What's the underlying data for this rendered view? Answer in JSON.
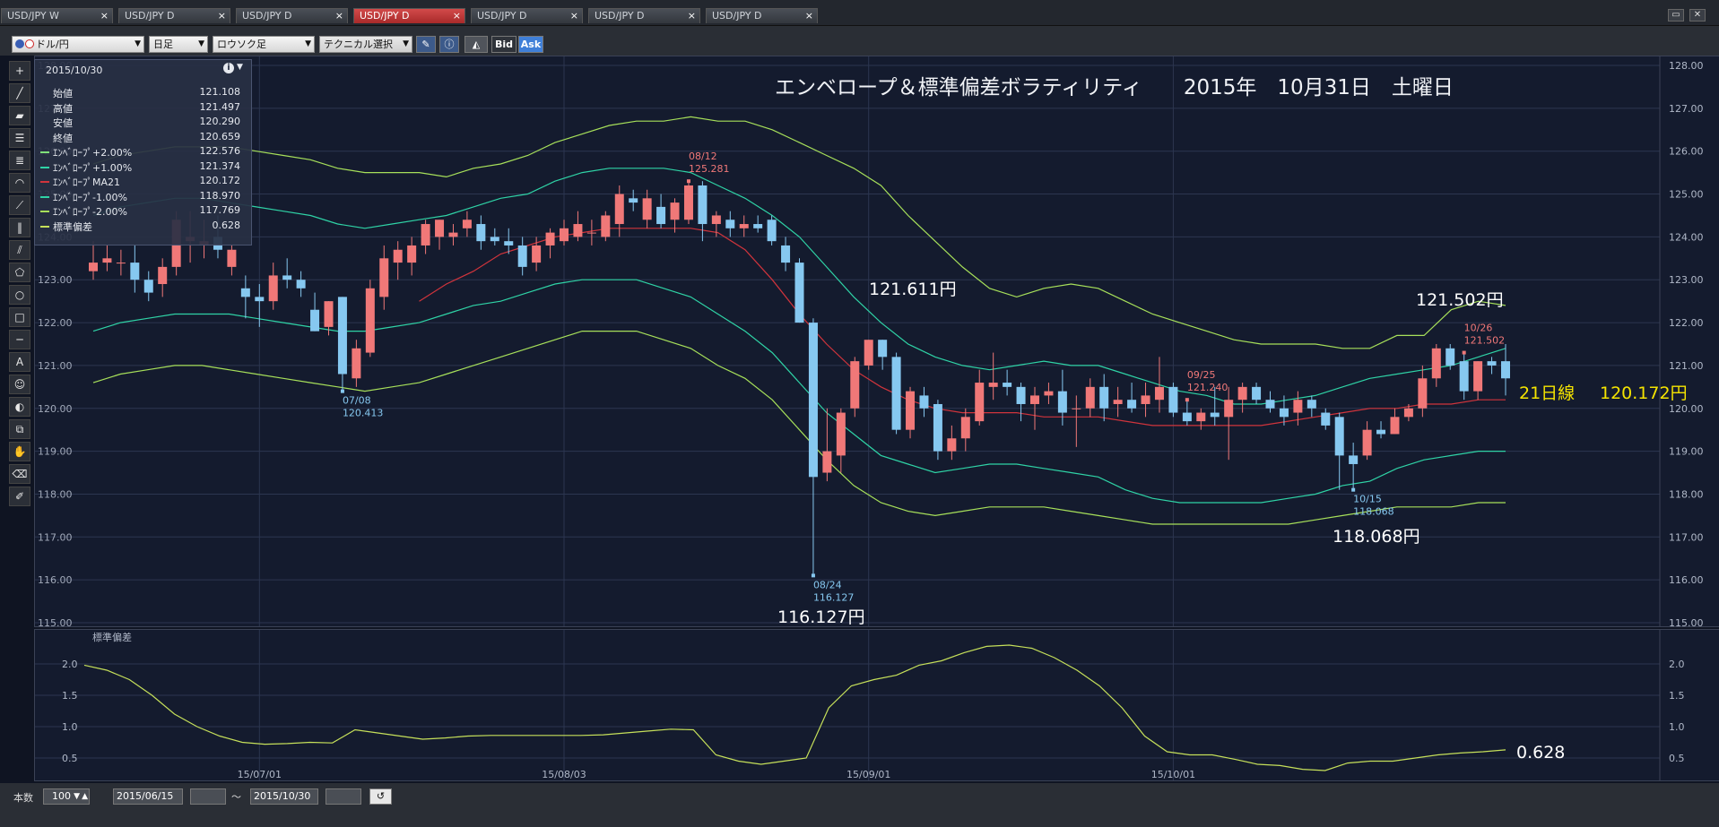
{
  "tabs": [
    {
      "label": "USD/JPY W",
      "active": false
    },
    {
      "label": "USD/JPY D",
      "active": false
    },
    {
      "label": "USD/JPY D",
      "active": false
    },
    {
      "label": "USD/JPY D",
      "active": true
    },
    {
      "label": "USD/JPY D",
      "active": false
    },
    {
      "label": "USD/JPY D",
      "active": false
    },
    {
      "label": "USD/JPY D",
      "active": false
    }
  ],
  "tab_close": "×",
  "toolbar": {
    "pair": "ドル/円",
    "period": "日足",
    "chart_type": "ロウソク足",
    "technical": "テクニカル選択",
    "bid": "Bid",
    "ask": "Ask"
  },
  "info_panel": {
    "date": "2015/10/30",
    "rows": [
      {
        "label": "始値",
        "value": "121.108"
      },
      {
        "label": "高値",
        "value": "121.497"
      },
      {
        "label": "安値",
        "value": "120.290"
      },
      {
        "label": "終値",
        "value": "120.659"
      },
      {
        "label": "ｴﾝﾍﾞﾛｰﾌﾟ+2.00%",
        "value": "122.576",
        "color": "#7fe07a"
      },
      {
        "label": "ｴﾝﾍﾞﾛｰﾌﾟ+1.00%",
        "value": "121.374",
        "color": "#2fd3a6"
      },
      {
        "label": "ｴﾝﾍﾞﾛｰﾌﾟMA21",
        "value": "120.172",
        "color": "#d0343c"
      },
      {
        "label": "ｴﾝﾍﾞﾛｰﾌﾟ-1.00%",
        "value": "118.970",
        "color": "#2fd3a6"
      },
      {
        "label": "ｴﾝﾍﾞﾛｰﾌﾟ-2.00%",
        "value": "117.769",
        "color": "#a7e05a"
      },
      {
        "label": "標準偏差",
        "value": "0.628",
        "color": "#c6e05a"
      }
    ]
  },
  "chart_title": "エンベロープ＆標準偏差ボラティリティ　　2015年　10月31日　土曜日",
  "colors": {
    "up": "#f07878",
    "down": "#86c8f0",
    "ma": "#d0343c",
    "env1": "#2fd3a6",
    "env2": "#a7e05a",
    "std": "#c6e05a",
    "grid": "#2c3650",
    "bg": "#141b2e"
  },
  "chart_data": {
    "type": "candlestick",
    "y_axis": {
      "min": 115,
      "max": 128,
      "ticks": [
        "128.00",
        "127.00",
        "126.00",
        "125.00",
        "124.00",
        "123.00",
        "122.00",
        "121.00",
        "120.00",
        "119.00",
        "118.00",
        "117.00",
        "116.00",
        "115.00"
      ]
    },
    "x_tick_labels": [
      "15/07/01",
      "15/08/03",
      "15/09/01",
      "15/10/01"
    ],
    "candles": [
      {
        "o": 123.2,
        "h": 123.9,
        "l": 123.0,
        "c": 123.4
      },
      {
        "o": 123.4,
        "h": 123.8,
        "l": 123.2,
        "c": 123.5
      },
      {
        "o": 123.4,
        "h": 123.7,
        "l": 123.1,
        "c": 123.4
      },
      {
        "o": 123.4,
        "h": 123.8,
        "l": 122.7,
        "c": 123.0
      },
      {
        "o": 123.0,
        "h": 123.2,
        "l": 122.5,
        "c": 122.7
      },
      {
        "o": 122.9,
        "h": 123.5,
        "l": 122.6,
        "c": 123.3
      },
      {
        "o": 123.3,
        "h": 124.6,
        "l": 123.1,
        "c": 124.4
      },
      {
        "o": 123.9,
        "h": 124.6,
        "l": 123.4,
        "c": 124.0
      },
      {
        "o": 123.8,
        "h": 124.4,
        "l": 123.5,
        "c": 123.9
      },
      {
        "o": 124.0,
        "h": 124.5,
        "l": 123.5,
        "c": 123.7
      },
      {
        "o": 123.3,
        "h": 123.8,
        "l": 123.1,
        "c": 123.7
      },
      {
        "o": 122.8,
        "h": 123.1,
        "l": 122.1,
        "c": 122.6
      },
      {
        "o": 122.6,
        "h": 122.9,
        "l": 121.9,
        "c": 122.5
      },
      {
        "o": 122.5,
        "h": 123.4,
        "l": 122.3,
        "c": 123.1
      },
      {
        "o": 123.1,
        "h": 123.5,
        "l": 122.8,
        "c": 123.0
      },
      {
        "o": 123.0,
        "h": 123.2,
        "l": 122.6,
        "c": 122.8
      },
      {
        "o": 122.3,
        "h": 122.7,
        "l": 121.8,
        "c": 121.8
      },
      {
        "o": 121.9,
        "h": 122.5,
        "l": 121.7,
        "c": 122.5
      },
      {
        "o": 122.6,
        "h": 122.6,
        "l": 120.4,
        "c": 120.8
      },
      {
        "o": 120.7,
        "h": 121.6,
        "l": 120.5,
        "c": 121.4
      },
      {
        "o": 121.3,
        "h": 123.0,
        "l": 121.2,
        "c": 122.8
      },
      {
        "o": 122.6,
        "h": 123.8,
        "l": 122.3,
        "c": 123.5
      },
      {
        "o": 123.4,
        "h": 123.9,
        "l": 123.0,
        "c": 123.7
      },
      {
        "o": 123.4,
        "h": 124.0,
        "l": 123.1,
        "c": 123.8
      },
      {
        "o": 123.8,
        "h": 124.4,
        "l": 123.6,
        "c": 124.3
      },
      {
        "o": 124.0,
        "h": 124.4,
        "l": 123.7,
        "c": 124.4
      },
      {
        "o": 124.0,
        "h": 124.3,
        "l": 123.8,
        "c": 124.1
      },
      {
        "o": 124.2,
        "h": 124.6,
        "l": 124.0,
        "c": 124.4
      },
      {
        "o": 124.3,
        "h": 124.5,
        "l": 123.7,
        "c": 123.9
      },
      {
        "o": 124.0,
        "h": 124.2,
        "l": 123.8,
        "c": 123.9
      },
      {
        "o": 123.9,
        "h": 124.2,
        "l": 123.6,
        "c": 123.8
      },
      {
        "o": 123.8,
        "h": 124.0,
        "l": 123.1,
        "c": 123.3
      },
      {
        "o": 123.4,
        "h": 124.0,
        "l": 123.2,
        "c": 123.8
      },
      {
        "o": 123.8,
        "h": 124.2,
        "l": 123.5,
        "c": 124.1
      },
      {
        "o": 123.9,
        "h": 124.4,
        "l": 123.8,
        "c": 124.2
      },
      {
        "o": 124.0,
        "h": 124.6,
        "l": 123.9,
        "c": 124.3
      },
      {
        "o": 124.1,
        "h": 124.4,
        "l": 123.8,
        "c": 124.1
      },
      {
        "o": 124.0,
        "h": 124.6,
        "l": 123.9,
        "c": 124.5
      },
      {
        "o": 124.3,
        "h": 125.2,
        "l": 124.0,
        "c": 125.0
      },
      {
        "o": 124.9,
        "h": 125.1,
        "l": 124.6,
        "c": 124.8
      },
      {
        "o": 124.4,
        "h": 125.1,
        "l": 124.2,
        "c": 124.9
      },
      {
        "o": 124.7,
        "h": 125.0,
        "l": 124.2,
        "c": 124.3
      },
      {
        "o": 124.4,
        "h": 124.9,
        "l": 124.1,
        "c": 124.8
      },
      {
        "o": 124.4,
        "h": 125.3,
        "l": 124.3,
        "c": 125.2
      },
      {
        "o": 125.2,
        "h": 125.3,
        "l": 123.9,
        "c": 124.3
      },
      {
        "o": 124.3,
        "h": 124.6,
        "l": 124.0,
        "c": 124.5
      },
      {
        "o": 124.4,
        "h": 124.6,
        "l": 124.0,
        "c": 124.2
      },
      {
        "o": 124.2,
        "h": 124.5,
        "l": 124.0,
        "c": 124.3
      },
      {
        "o": 124.3,
        "h": 124.5,
        "l": 124.1,
        "c": 124.2
      },
      {
        "o": 124.4,
        "h": 124.5,
        "l": 123.8,
        "c": 123.9
      },
      {
        "o": 123.8,
        "h": 124.0,
        "l": 123.2,
        "c": 123.4
      },
      {
        "o": 123.4,
        "h": 123.5,
        "l": 122.0,
        "c": 122.0
      },
      {
        "o": 122.0,
        "h": 122.1,
        "l": 116.1,
        "c": 118.4
      },
      {
        "o": 118.5,
        "h": 120.0,
        "l": 118.3,
        "c": 119.0
      },
      {
        "o": 118.9,
        "h": 120.0,
        "l": 118.5,
        "c": 119.9
      },
      {
        "o": 120.0,
        "h": 121.2,
        "l": 119.8,
        "c": 121.1
      },
      {
        "o": 121.0,
        "h": 121.6,
        "l": 120.9,
        "c": 121.6
      },
      {
        "o": 121.6,
        "h": 121.6,
        "l": 120.9,
        "c": 121.2
      },
      {
        "o": 121.2,
        "h": 121.3,
        "l": 119.4,
        "c": 119.5
      },
      {
        "o": 119.5,
        "h": 120.5,
        "l": 119.3,
        "c": 120.4
      },
      {
        "o": 120.3,
        "h": 120.5,
        "l": 119.8,
        "c": 120.0
      },
      {
        "o": 120.1,
        "h": 120.2,
        "l": 118.8,
        "c": 119.0
      },
      {
        "o": 119.0,
        "h": 119.6,
        "l": 118.8,
        "c": 119.3
      },
      {
        "o": 119.3,
        "h": 120.0,
        "l": 119.0,
        "c": 119.8
      },
      {
        "o": 119.7,
        "h": 120.9,
        "l": 119.6,
        "c": 120.6
      },
      {
        "o": 120.5,
        "h": 121.3,
        "l": 120.2,
        "c": 120.6
      },
      {
        "o": 120.6,
        "h": 120.9,
        "l": 120.3,
        "c": 120.5
      },
      {
        "o": 120.5,
        "h": 120.6,
        "l": 119.7,
        "c": 120.1
      },
      {
        "o": 120.1,
        "h": 120.5,
        "l": 119.5,
        "c": 120.3
      },
      {
        "o": 120.3,
        "h": 120.6,
        "l": 120.1,
        "c": 120.4
      },
      {
        "o": 120.4,
        "h": 120.9,
        "l": 119.6,
        "c": 119.9
      },
      {
        "o": 120.0,
        "h": 120.3,
        "l": 119.1,
        "c": 120.0
      },
      {
        "o": 120.0,
        "h": 120.7,
        "l": 119.8,
        "c": 120.5
      },
      {
        "o": 120.5,
        "h": 120.8,
        "l": 119.7,
        "c": 120.0
      },
      {
        "o": 120.1,
        "h": 120.5,
        "l": 119.8,
        "c": 120.2
      },
      {
        "o": 120.2,
        "h": 120.6,
        "l": 119.9,
        "c": 120.0
      },
      {
        "o": 120.1,
        "h": 120.6,
        "l": 119.8,
        "c": 120.3
      },
      {
        "o": 120.2,
        "h": 121.2,
        "l": 119.9,
        "c": 120.5
      },
      {
        "o": 120.5,
        "h": 120.6,
        "l": 119.8,
        "c": 119.9
      },
      {
        "o": 119.9,
        "h": 120.2,
        "l": 119.6,
        "c": 119.7
      },
      {
        "o": 119.7,
        "h": 120.0,
        "l": 119.5,
        "c": 119.9
      },
      {
        "o": 119.9,
        "h": 120.5,
        "l": 119.6,
        "c": 119.8
      },
      {
        "o": 119.8,
        "h": 120.5,
        "l": 118.8,
        "c": 120.2
      },
      {
        "o": 120.2,
        "h": 120.6,
        "l": 119.9,
        "c": 120.5
      },
      {
        "o": 120.5,
        "h": 120.6,
        "l": 120.1,
        "c": 120.2
      },
      {
        "o": 120.2,
        "h": 120.4,
        "l": 119.9,
        "c": 120.0
      },
      {
        "o": 120.0,
        "h": 120.3,
        "l": 119.6,
        "c": 119.8
      },
      {
        "o": 119.9,
        "h": 120.4,
        "l": 119.6,
        "c": 120.2
      },
      {
        "o": 120.2,
        "h": 120.3,
        "l": 119.8,
        "c": 120.0
      },
      {
        "o": 119.9,
        "h": 120.0,
        "l": 119.5,
        "c": 119.6
      },
      {
        "o": 119.8,
        "h": 119.9,
        "l": 118.1,
        "c": 118.9
      },
      {
        "o": 118.9,
        "h": 119.2,
        "l": 118.1,
        "c": 118.7
      },
      {
        "o": 118.9,
        "h": 119.7,
        "l": 118.8,
        "c": 119.5
      },
      {
        "o": 119.5,
        "h": 119.7,
        "l": 119.3,
        "c": 119.4
      },
      {
        "o": 119.4,
        "h": 120.0,
        "l": 119.4,
        "c": 119.8
      },
      {
        "o": 119.8,
        "h": 120.1,
        "l": 119.7,
        "c": 120.0
      },
      {
        "o": 120.0,
        "h": 121.0,
        "l": 119.8,
        "c": 120.7
      },
      {
        "o": 120.7,
        "h": 121.5,
        "l": 120.5,
        "c": 121.4
      },
      {
        "o": 121.4,
        "h": 121.5,
        "l": 120.9,
        "c": 121.0
      },
      {
        "o": 121.1,
        "h": 121.3,
        "l": 120.2,
        "c": 120.4
      },
      {
        "o": 120.4,
        "h": 121.1,
        "l": 120.2,
        "c": 121.1
      },
      {
        "o": 121.1,
        "h": 121.2,
        "l": 120.8,
        "c": 121.0
      },
      {
        "o": 121.1,
        "h": 121.5,
        "l": 120.3,
        "c": 120.7
      }
    ],
    "series": [
      {
        "name": "ｴﾝﾍﾞﾛｰﾌﾟ+2.00%",
        "values": [
          125.7,
          125.9,
          126.0,
          126.1,
          126.1,
          126.1,
          126.0,
          125.9,
          125.8,
          125.6,
          125.5,
          125.5,
          125.5,
          125.4,
          125.6,
          125.7,
          125.9,
          126.2,
          126.4,
          126.6,
          126.7,
          126.7,
          126.8,
          126.7,
          126.7,
          126.5,
          126.2,
          125.9,
          125.6,
          125.2,
          124.5,
          123.9,
          123.3,
          122.8,
          122.6,
          122.8,
          122.9,
          122.8,
          122.5,
          122.2,
          122.0,
          121.8,
          121.6,
          121.5,
          121.5,
          121.5,
          121.4,
          121.4,
          121.7,
          121.7,
          122.3,
          122.5,
          122.4
        ]
      },
      {
        "name": "ｴﾝﾍﾞﾛｰﾌﾟ+1.00%",
        "values": [
          124.5,
          124.7,
          124.8,
          124.9,
          124.9,
          124.8,
          124.7,
          124.6,
          124.5,
          124.3,
          124.2,
          124.3,
          124.4,
          124.5,
          124.7,
          124.9,
          125.0,
          125.3,
          125.5,
          125.6,
          125.6,
          125.6,
          125.5,
          125.2,
          124.9,
          124.5,
          124.0,
          123.3,
          122.6,
          122.0,
          121.5,
          121.2,
          121.0,
          120.9,
          121.0,
          121.1,
          121.0,
          121.0,
          120.8,
          120.6,
          120.4,
          120.3,
          120.1,
          120.1,
          120.2,
          120.3,
          120.5,
          120.7,
          120.8,
          120.9,
          121.0,
          121.2,
          121.4
        ]
      },
      {
        "name": "ｴﾝﾍﾞﾛｰﾌﾟ-1.00%",
        "values": [
          121.8,
          122.0,
          122.1,
          122.2,
          122.2,
          122.2,
          122.1,
          122.0,
          121.9,
          121.8,
          121.8,
          121.9,
          122.0,
          122.2,
          122.4,
          122.5,
          122.7,
          122.9,
          123.0,
          123.0,
          123.0,
          122.8,
          122.6,
          122.2,
          121.8,
          121.3,
          120.6,
          119.9,
          119.4,
          118.9,
          118.7,
          118.5,
          118.6,
          118.7,
          118.7,
          118.6,
          118.5,
          118.4,
          118.1,
          117.9,
          117.8,
          117.8,
          117.8,
          117.8,
          117.9,
          118.0,
          118.2,
          118.3,
          118.6,
          118.8,
          118.9,
          119.0,
          119.0
        ]
      },
      {
        "name": "ｴﾝﾍﾞﾛｰﾌﾟ-2.00%",
        "values": [
          120.6,
          120.8,
          120.9,
          121.0,
          121.0,
          120.9,
          120.8,
          120.7,
          120.6,
          120.5,
          120.4,
          120.5,
          120.6,
          120.8,
          121.0,
          121.2,
          121.4,
          121.6,
          121.8,
          121.8,
          121.8,
          121.6,
          121.4,
          121.0,
          120.7,
          120.2,
          119.5,
          118.8,
          118.2,
          117.8,
          117.6,
          117.5,
          117.6,
          117.7,
          117.7,
          117.7,
          117.6,
          117.5,
          117.4,
          117.3,
          117.3,
          117.3,
          117.3,
          117.3,
          117.3,
          117.4,
          117.5,
          117.6,
          117.7,
          117.7,
          117.7,
          117.8,
          117.8
        ]
      },
      {
        "name": "ｴﾝﾍﾞﾛｰﾌﾟMA21",
        "values": [
          null,
          null,
          null,
          null,
          null,
          null,
          null,
          null,
          null,
          null,
          null,
          null,
          122.5,
          122.9,
          123.2,
          123.6,
          123.8,
          124.0,
          124.1,
          124.2,
          124.2,
          124.2,
          124.2,
          124.1,
          123.7,
          123.0,
          122.2,
          121.5,
          120.9,
          120.5,
          120.2,
          120.0,
          119.9,
          119.9,
          119.9,
          119.8,
          119.8,
          119.8,
          119.7,
          119.6,
          119.6,
          119.6,
          119.6,
          119.6,
          119.7,
          119.8,
          119.9,
          120.0,
          120.0,
          120.1,
          120.1,
          120.2,
          120.2
        ]
      }
    ],
    "annotations": [
      {
        "date": "08/12",
        "value": "125.281",
        "kind": "high"
      },
      {
        "date": "07/08",
        "value": "120.413",
        "kind": "low"
      },
      {
        "date": "08/24",
        "value": "116.127",
        "kind": "low"
      },
      {
        "date": "09/25",
        "value": "121.240",
        "kind": "high"
      },
      {
        "date": "10/15",
        "value": "118.068",
        "kind": "low"
      },
      {
        "date": "10/26",
        "value": "121.502",
        "kind": "high"
      }
    ],
    "big_labels": {
      "a": "121.611円",
      "b": "121.502円",
      "c": "116.127円",
      "d": "118.068円",
      "e": "0.628"
    },
    "ma_label": "21日線",
    "ma_value": "120.172円",
    "sub": {
      "title": "標準偏差",
      "y_ticks": [
        "2.0",
        "1.5",
        "1.0",
        "0.5"
      ],
      "ylim": [
        0.2,
        2.4
      ],
      "values": [
        1.98,
        1.9,
        1.75,
        1.5,
        1.2,
        1.0,
        0.85,
        0.75,
        0.72,
        0.73,
        0.75,
        0.74,
        0.95,
        0.9,
        0.85,
        0.8,
        0.82,
        0.85,
        0.86,
        0.86,
        0.86,
        0.86,
        0.86,
        0.87,
        0.9,
        0.93,
        0.96,
        0.95,
        0.55,
        0.45,
        0.4,
        0.45,
        0.5,
        1.3,
        1.65,
        1.75,
        1.82,
        1.98,
        2.05,
        2.18,
        2.28,
        2.3,
        2.25,
        2.1,
        1.9,
        1.65,
        1.3,
        0.85,
        0.6,
        0.55,
        0.55,
        0.48,
        0.4,
        0.38,
        0.32,
        0.3,
        0.42,
        0.45,
        0.45,
        0.5,
        0.55,
        0.58,
        0.6,
        0.63
      ]
    }
  },
  "bottombar": {
    "count_label": "本数",
    "count_value": "100",
    "from_date": "2015/06/15",
    "tilde": "～",
    "to_date": "2015/10/30"
  }
}
